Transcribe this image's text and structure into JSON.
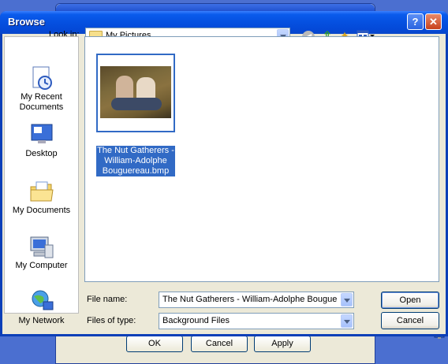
{
  "dialog": {
    "title": "Browse",
    "help_label": "?",
    "close_label": "✕"
  },
  "lookin": {
    "label": "Look in:",
    "value": "My Pictures"
  },
  "places": [
    {
      "label": "My Recent Documents",
      "icon": "recent-documents-icon"
    },
    {
      "label": "Desktop",
      "icon": "desktop-icon"
    },
    {
      "label": "My Documents",
      "icon": "my-documents-icon"
    },
    {
      "label": "My Computer",
      "icon": "my-computer-icon"
    },
    {
      "label": "My Network",
      "icon": "my-network-icon"
    }
  ],
  "files": [
    {
      "name": "The Nut Gatherers - William-Adolphe Bouguereau.bmp",
      "selected": true
    }
  ],
  "filename": {
    "label": "File name:",
    "value": "The Nut Gatherers - William-Adolphe Bouguere"
  },
  "filetype": {
    "label": "Files of type:",
    "value": "Background Files"
  },
  "buttons": {
    "open": "Open",
    "cancel": "Cancel"
  },
  "background_window": {
    "ok": "OK",
    "cancel": "Cancel",
    "apply": "Apply"
  }
}
